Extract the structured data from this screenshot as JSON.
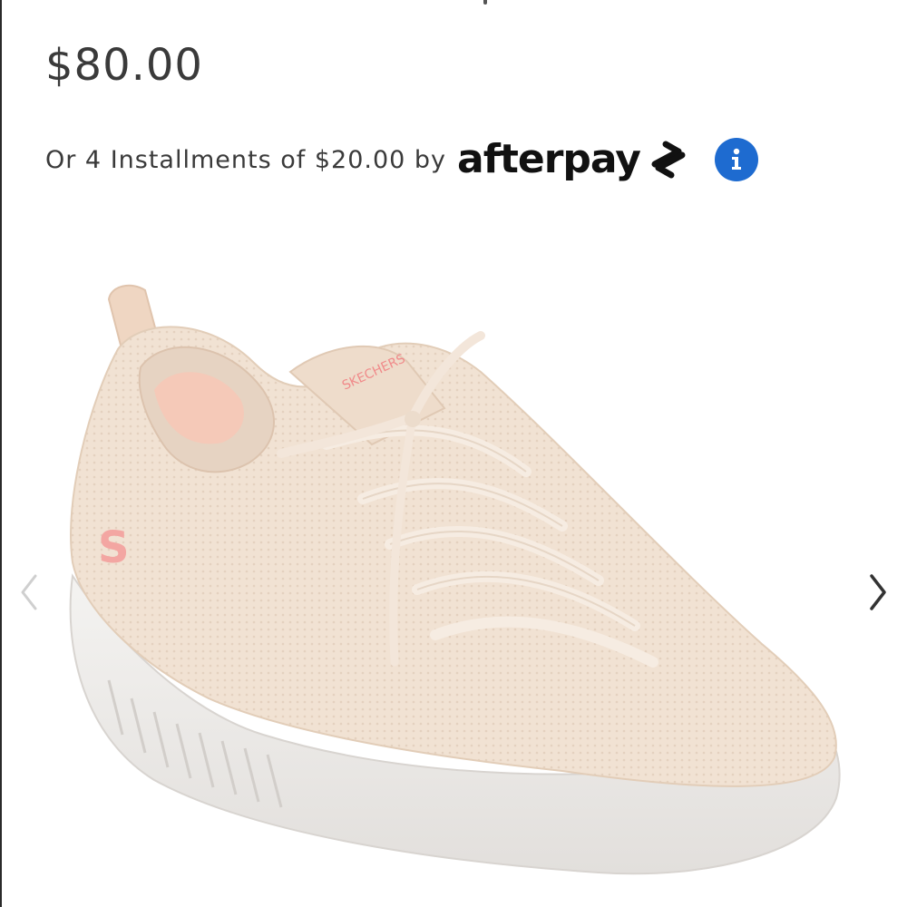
{
  "product": {
    "price": "$80.00",
    "installments_text": "Or 4 Installments of $20.00 by",
    "afterpay_label": "afterpay",
    "info_icon": "info-icon",
    "image_description_icon": "product-image"
  },
  "carousel": {
    "prev_icon": "chevron-left-icon",
    "next_icon": "chevron-right-icon"
  },
  "colors": {
    "info_button": "#1e6bd0",
    "shoe_upper": "#f1e2d3",
    "shoe_sole": "#eeecea",
    "logo_accent": "#f08a8a"
  }
}
